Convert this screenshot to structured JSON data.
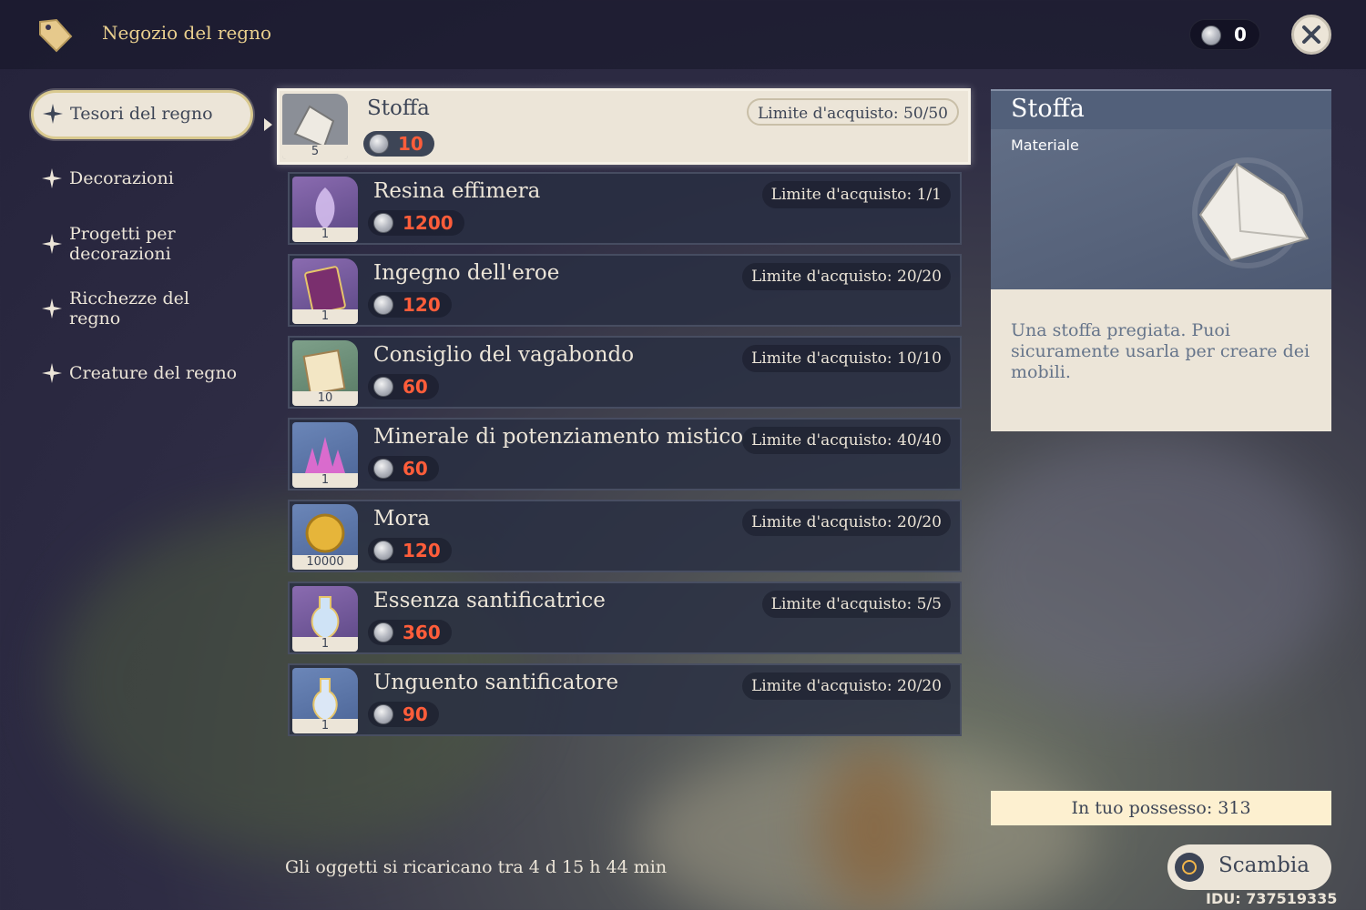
{
  "header": {
    "title": "Negozio del regno",
    "currency_balance": "0",
    "close_icon": "close-icon"
  },
  "sidebar": {
    "items": [
      {
        "label": "Tesori del regno",
        "active": true
      },
      {
        "label": "Decorazioni"
      },
      {
        "label_lines": [
          "Progetti per",
          "decorazioni"
        ]
      },
      {
        "label_lines": [
          "Ricchezze del",
          "regno"
        ]
      },
      {
        "label": "Creature del regno"
      }
    ]
  },
  "items": [
    {
      "name": "Stoffa",
      "qty": "5",
      "price": "10",
      "limit": "Limite d'acquisto: 50/50",
      "icon": "cloth-icon"
    },
    {
      "name": "Resina effimera",
      "qty": "1",
      "price": "1200",
      "limit": "Limite d'acquisto: 1/1",
      "icon": "resin-icon"
    },
    {
      "name": "Ingegno dell'eroe",
      "qty": "1",
      "price": "120",
      "limit": "Limite d'acquisto: 20/20",
      "icon": "book-icon"
    },
    {
      "name": "Consiglio del vagabondo",
      "qty": "10",
      "price": "60",
      "limit": "Limite d'acquisto: 10/10",
      "icon": "scroll-icon"
    },
    {
      "name": "Minerale di potenziamento mistico",
      "qty": "1",
      "price": "60",
      "limit": "Limite d'acquisto: 40/40",
      "icon": "crystal-icon"
    },
    {
      "name": "Mora",
      "qty": "10000",
      "price": "120",
      "limit": "Limite d'acquisto: 20/20",
      "icon": "mora-coin-icon"
    },
    {
      "name": "Essenza santificatrice",
      "qty": "1",
      "price": "360",
      "limit": "Limite d'acquisto: 5/5",
      "icon": "essence-flask-icon"
    },
    {
      "name": "Unguento santificatore",
      "qty": "1",
      "price": "90",
      "limit": "Limite d'acquisto: 20/20",
      "icon": "unction-flask-icon"
    }
  ],
  "detail": {
    "title": "Stoffa",
    "type": "Materiale",
    "description": "Una stoffa pregiata. Puoi sicuramente usarla per creare dei mobili.",
    "owned": "In tuo possesso: 313"
  },
  "footer": {
    "restock": "Gli oggetti si ricaricano tra 4 d 15 h 44 min",
    "exchange_label": "Scambia",
    "uid": "IDU: 737519335"
  },
  "colors": {
    "accent_gold": "#e9cf8e",
    "price_red": "#ff5d3a",
    "panel_cream": "#ece5d8",
    "panel_slate": "#3d4556"
  }
}
